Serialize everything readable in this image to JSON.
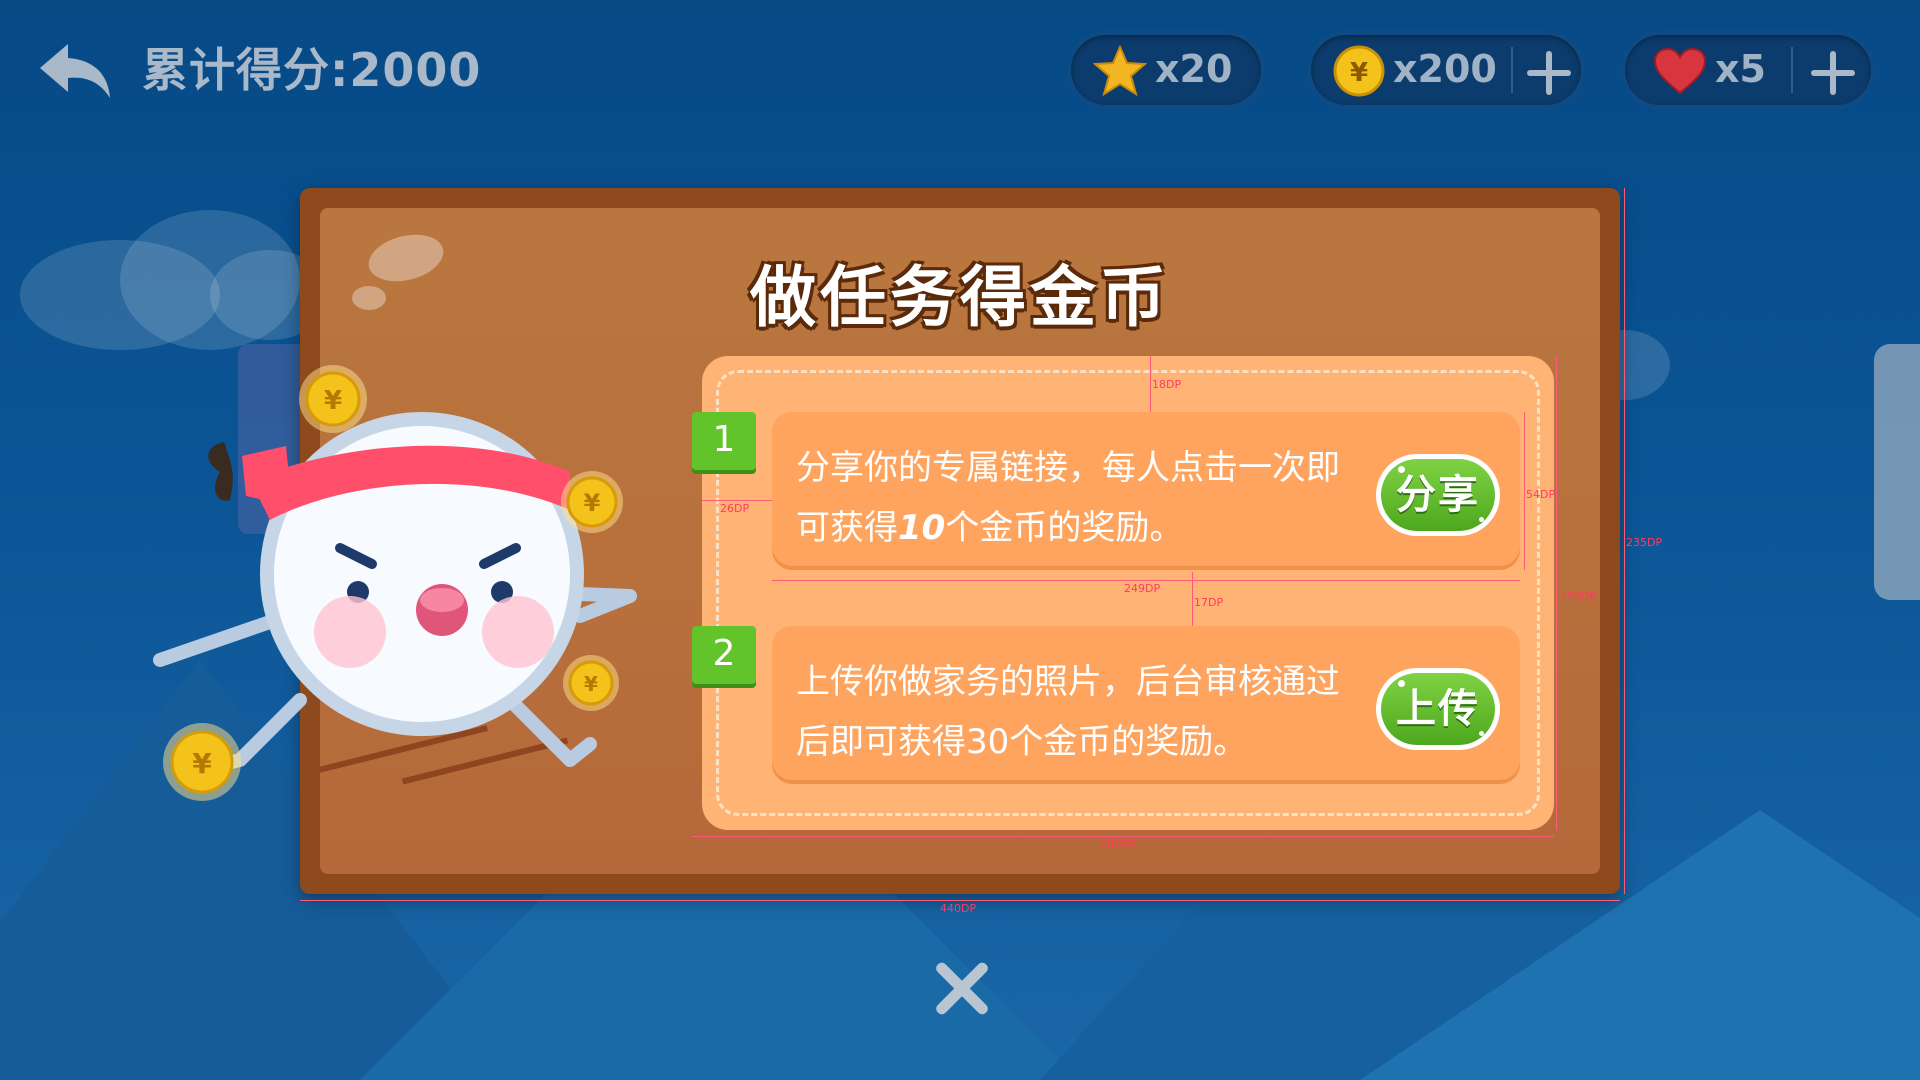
{
  "top_bar": {
    "score_label": "累计得分:2000",
    "stars": {
      "icon": "star-icon",
      "count": "x20"
    },
    "gold_coins": {
      "icon": "yuan-coin-icon",
      "count": "x200"
    },
    "lives": {
      "icon": "heart-icon",
      "count": "x5"
    }
  },
  "dialog": {
    "title": "做任务得金币",
    "tasks": [
      {
        "number": "1",
        "text_before": "分享你的专属链接，每人点击一次即可获得",
        "amount": "10",
        "text_after": "个金币的奖励。",
        "button_label": "分享"
      },
      {
        "number": "2",
        "text": "上传你做家务的照片，后台审核通过后即可获得30个金币的奖励。",
        "button_label": "上传"
      }
    ]
  },
  "annotations": {
    "top_gap": "18DP",
    "left_gap": "26DP",
    "card_height": "54DP",
    "card_width": "249DP",
    "card_gap": "17DP",
    "panel_height": "158DP",
    "panel_width": "288DP",
    "dialog_height": "235DP",
    "dialog_width": "440DP"
  },
  "colors": {
    "background": "#0b5596",
    "board": "#b8703c",
    "panel": "#ffb375",
    "card": "#ffa45e",
    "button_green": "#5cb82a",
    "annotation": "#ff3b5c"
  }
}
